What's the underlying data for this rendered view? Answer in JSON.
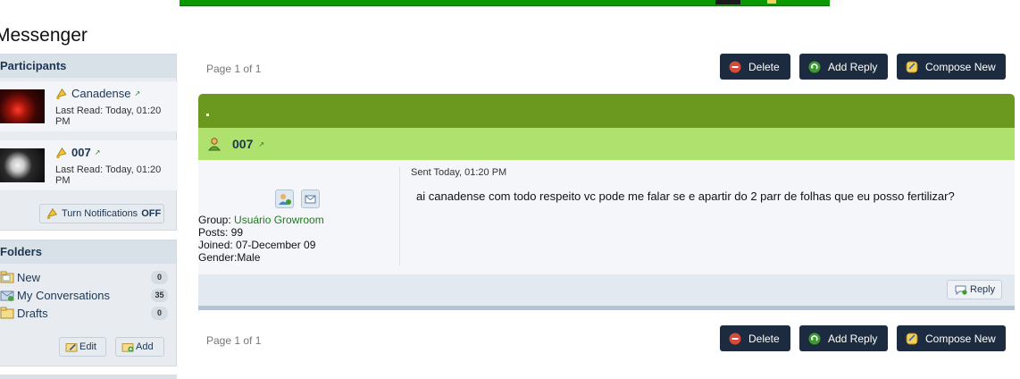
{
  "page": {
    "title": "Messenger"
  },
  "participants": {
    "heading": "Participants",
    "items": [
      {
        "name": "Canadense",
        "last_read": "Last Read: Today, 01:20 PM"
      },
      {
        "name": "007",
        "last_read": "Last Read: Today, 01:20 PM"
      }
    ],
    "notify_label": "Turn Notifications",
    "notify_state": "OFF"
  },
  "folders": {
    "heading": "Folders",
    "items": [
      {
        "label": "New",
        "count": "0"
      },
      {
        "label": "My Conversations",
        "count": "35"
      },
      {
        "label": "Drafts",
        "count": "0"
      }
    ],
    "edit_label": "Edit",
    "add_label": "Add"
  },
  "toolbar": {
    "page_info": "Page 1 of 1",
    "delete_label": "Delete",
    "add_reply_label": "Add Reply",
    "compose_label": "Compose New"
  },
  "post": {
    "author": "007",
    "sent": "Sent Today, 01:20 PM",
    "message": "ai canadense com todo respeito vc pode me falar se e apartir do 2 parr de folhas que eu posso fertilizar?",
    "group_label": "Group:",
    "group_value": "Usuário Growroom",
    "posts": "Posts: 99",
    "joined": "Joined: 07-December 09",
    "gender": "Gender:Male",
    "reply_label": "Reply"
  },
  "colors": {
    "accent_dark": "#1c2b3f",
    "post_header_green": "#6b981e",
    "author_bar_green": "#afe16e",
    "group_green": "#1d7a1d"
  }
}
